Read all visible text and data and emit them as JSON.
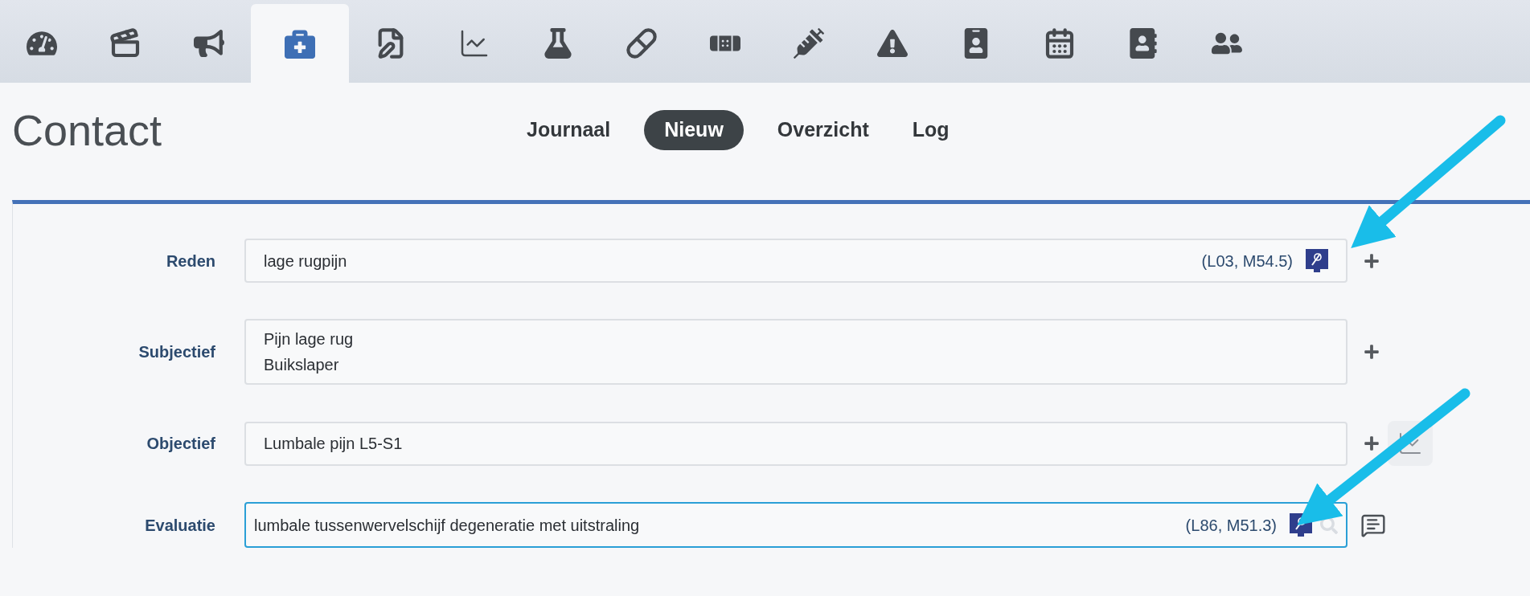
{
  "toolbar": [
    {
      "kind": "gauge",
      "selected": false
    },
    {
      "kind": "clapperboard",
      "selected": false
    },
    {
      "kind": "megaphone",
      "selected": false
    },
    {
      "kind": "medkit",
      "selected": true
    },
    {
      "kind": "edit",
      "selected": false
    },
    {
      "kind": "chart",
      "selected": false
    },
    {
      "kind": "flask",
      "selected": false
    },
    {
      "kind": "pill",
      "selected": false
    },
    {
      "kind": "bandage",
      "selected": false
    },
    {
      "kind": "syringe",
      "selected": false
    },
    {
      "kind": "warning",
      "selected": false
    },
    {
      "kind": "badge",
      "selected": false
    },
    {
      "kind": "calendar",
      "selected": false
    },
    {
      "kind": "book",
      "selected": false
    },
    {
      "kind": "users",
      "selected": false
    }
  ],
  "title": "Contact",
  "nav": [
    {
      "label": "Journaal",
      "selected": false
    },
    {
      "label": "Nieuw",
      "selected": true
    },
    {
      "label": "Overzicht",
      "selected": false
    },
    {
      "label": "Log",
      "selected": false
    }
  ],
  "fields": [
    {
      "label": "Reden",
      "lines": [
        "lage rugpijn"
      ],
      "code": "(L03, M54.5)",
      "focused": false,
      "inner_icons": [
        {
          "kind": "coding"
        }
      ],
      "actions": [
        {
          "kind": "plus"
        }
      ]
    },
    {
      "label": "Subjectief",
      "lines": [
        "Pijn lage rug",
        "Buikslaper"
      ],
      "focused": false,
      "actions": [
        {
          "kind": "plus"
        }
      ]
    },
    {
      "label": "Objectief",
      "lines": [
        "Lumbale pijn L5-S1"
      ],
      "focused": false,
      "actions": [
        {
          "kind": "plus"
        },
        {
          "kind": "chart"
        }
      ]
    },
    {
      "label": "Evaluatie",
      "lines": [
        "lumbale tussenwervelschijf degeneratie met uitstraling"
      ],
      "code": "(L86, M51.3)",
      "focused": true,
      "inner_icons": [
        {
          "kind": "coding"
        },
        {
          "kind": "search"
        }
      ],
      "actions": [
        {
          "kind": "comment"
        }
      ]
    }
  ]
}
